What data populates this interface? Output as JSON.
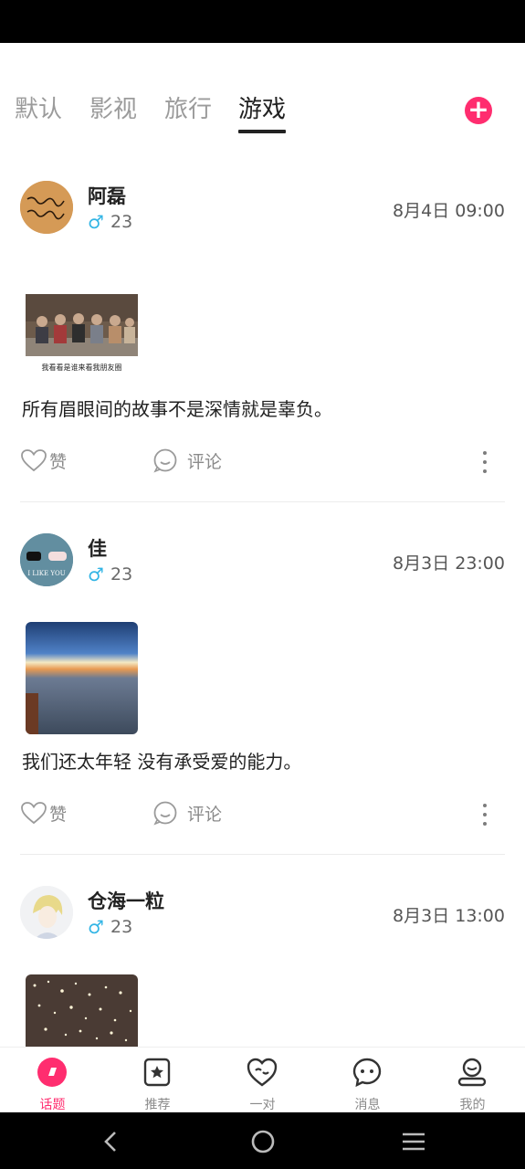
{
  "tabs": [
    {
      "label": "默认",
      "active": false
    },
    {
      "label": "影视",
      "active": false
    },
    {
      "label": "旅行",
      "active": false
    },
    {
      "label": "游戏",
      "active": true
    }
  ],
  "posts": [
    {
      "username": "阿磊",
      "gender": "♂",
      "age": "23",
      "time": "8月4日 09:00",
      "text": "所有眉眼间的故事不是深情就是辜负。",
      "image_caption": "我看看是谁来看我朋友圈",
      "like_label": "赞",
      "comment_label": "评论"
    },
    {
      "username": "佳",
      "gender": "♂",
      "age": "23",
      "time": "8月3日 23:00",
      "avatar_text": "I LIKE YOU",
      "text": "我们还太年轻 没有承受爱的能力。",
      "like_label": "赞",
      "comment_label": "评论"
    },
    {
      "username": "仓海一粒",
      "gender": "♂",
      "age": "23",
      "time": "8月3日 13:00"
    }
  ],
  "bottom_nav": [
    {
      "label": "话题",
      "icon": "topic-icon",
      "active": true
    },
    {
      "label": "推荐",
      "icon": "recommend-icon",
      "active": false
    },
    {
      "label": "一对",
      "icon": "match-icon",
      "active": false
    },
    {
      "label": "消息",
      "icon": "message-icon",
      "active": false
    },
    {
      "label": "我的",
      "icon": "profile-icon",
      "active": false
    }
  ],
  "colors": {
    "accent": "#ff2d6f",
    "male": "#33b5e5",
    "muted_text": "#8a8a8a"
  }
}
